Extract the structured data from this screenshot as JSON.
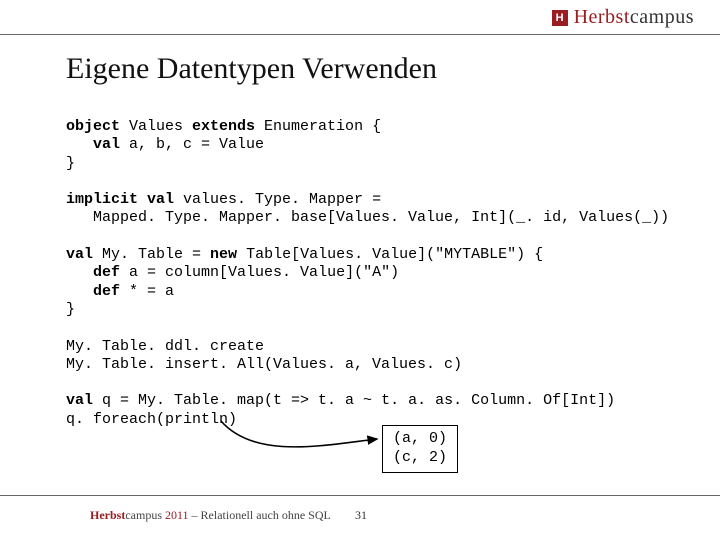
{
  "logo": {
    "mark_letter": "H",
    "brand_strong": "Herbst",
    "brand_rest": "campus"
  },
  "title": "Eigene Datentypen Verwenden",
  "code": {
    "l01a": "object",
    "l01b": " Values ",
    "l01c": "extends",
    "l01d": " Enumeration {",
    "l02a": "   ",
    "l02b": "val",
    "l02c": " a, b, c = Value",
    "l03": "}",
    "l05a": "implicit val",
    "l05b": " values. Type. Mapper =",
    "l06": "   Mapped. Type. Mapper. base[Values. Value, Int](_. id, Values(_))",
    "l08a": "val",
    "l08b": " My. Table = ",
    "l08c": "new",
    "l08d": " Table[Values. Value](",
    "l08e": "\"MYTABLE\"",
    "l08f": ") {",
    "l09a": "   ",
    "l09b": "def",
    "l09c": " a = column[Values. Value](",
    "l09d": "\"A\"",
    "l09e": ")",
    "l10a": "   ",
    "l10b": "def",
    "l10c": " * = a",
    "l11": "}",
    "l13": "My. Table. ddl. create",
    "l14": "My. Table. insert. All(Values. a, Values. c)",
    "l16a": "val",
    "l16b": " q = My. Table. map(t => t. a ~ t. a. as. Column. Of[Int])",
    "l17": "q. foreach(println)"
  },
  "callout": {
    "line1": "(a, 0)",
    "line2": "(c, 2)"
  },
  "footer": {
    "brand_strong": "Herbst",
    "brand_rest": "campus",
    "year": " 2011",
    "rest": " – Relationell auch ohne SQL"
  },
  "page_number": "31"
}
